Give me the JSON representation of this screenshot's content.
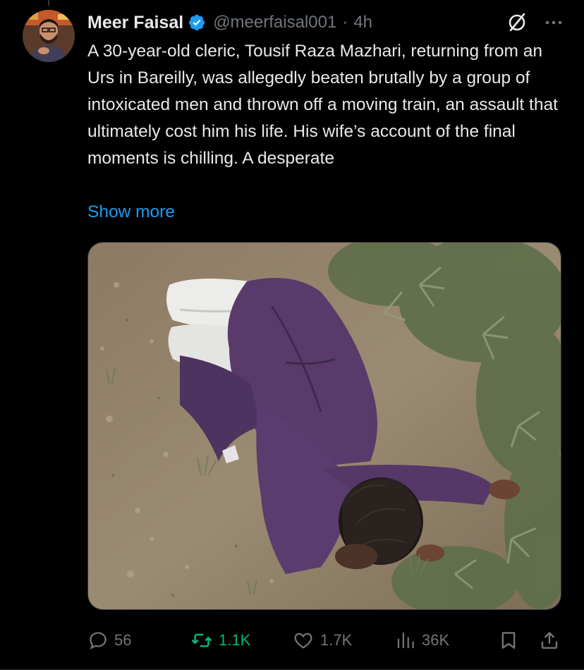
{
  "tweet": {
    "author_name": "Meer Faisal",
    "handle": "@meerfaisal001",
    "separator": "·",
    "time": "4h",
    "text": "A 30-year-old cleric, Tousif Raza Mazhari, returning from an Urs in Bareilly, was allegedly beaten brutally by a group of intoxicated men and thrown off a moving train, an assault that ultimately cost him his life. His wife’s account of the final moments is chilling. A desperate",
    "show_more": "Show more",
    "verified_badge": "verified-badge-icon",
    "media_description_icon": "photo"
  },
  "actions": {
    "replies": "56",
    "reposts": "1.1K",
    "likes": "1.7K",
    "views": "36K"
  },
  "colors": {
    "background": "#000000",
    "text": "#e7e9ea",
    "muted": "#71767b",
    "link": "#1d9bf0",
    "repost": "#00ba7c"
  }
}
